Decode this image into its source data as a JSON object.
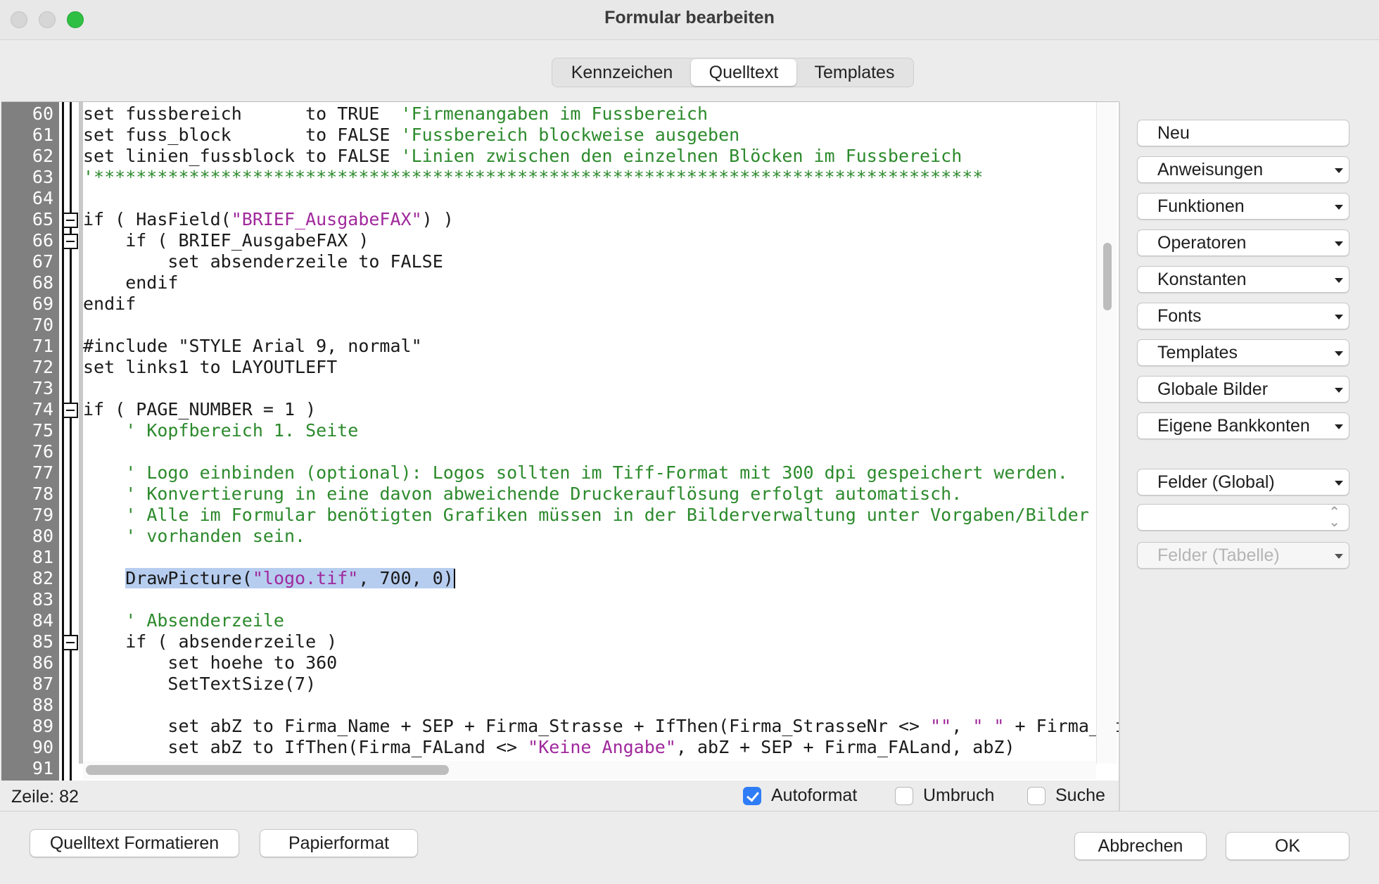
{
  "window": {
    "title": "Formular bearbeiten",
    "accent_color": "#2f7df6",
    "code_comment_color": "#2c8a2c",
    "code_string_color": "#a0289c",
    "selection_color": "#b6cdef"
  },
  "tabs": [
    {
      "label": "Kennzeichen",
      "selected": false
    },
    {
      "label": "Quelltext",
      "selected": true
    },
    {
      "label": "Templates",
      "selected": false
    }
  ],
  "editor": {
    "lines": [
      {
        "n": "60",
        "segs": [
          {
            "t": "set fussbereich      to TRUE  "
          },
          {
            "t": "'Firmenangaben im Fussbereich",
            "c": "com"
          }
        ]
      },
      {
        "n": "61",
        "segs": [
          {
            "t": "set fuss_block       to FALSE "
          },
          {
            "t": "'Fussbereich blockweise ausgeben",
            "c": "com"
          }
        ]
      },
      {
        "n": "62",
        "segs": [
          {
            "t": "set linien_fussblock to FALSE "
          },
          {
            "t": "'Linien zwischen den einzelnen Blöcken im Fussbereich",
            "c": "com"
          }
        ]
      },
      {
        "n": "63",
        "segs": [
          {
            "t": "'************************************************************************************",
            "c": "com"
          }
        ]
      },
      {
        "n": "64",
        "segs": []
      },
      {
        "n": "65",
        "fold": true,
        "segs": [
          {
            "t": "if ( HasField("
          },
          {
            "t": "\"BRIEF_AusgabeFAX\"",
            "c": "str"
          },
          {
            "t": ") )"
          }
        ]
      },
      {
        "n": "66",
        "fold": true,
        "segs": [
          {
            "t": "    if ( BRIEF_AusgabeFAX )"
          }
        ]
      },
      {
        "n": "67",
        "segs": [
          {
            "t": "        set absenderzeile to FALSE"
          }
        ]
      },
      {
        "n": "68",
        "segs": [
          {
            "t": "    endif"
          }
        ]
      },
      {
        "n": "69",
        "segs": [
          {
            "t": "endif"
          }
        ]
      },
      {
        "n": "70",
        "segs": []
      },
      {
        "n": "71",
        "segs": [
          {
            "t": "#include \"STYLE Arial 9, normal\""
          }
        ]
      },
      {
        "n": "72",
        "segs": [
          {
            "t": "set links1 to LAYOUTLEFT"
          }
        ]
      },
      {
        "n": "73",
        "segs": []
      },
      {
        "n": "74",
        "fold": true,
        "segs": [
          {
            "t": "if ( PAGE_NUMBER = 1 )"
          }
        ]
      },
      {
        "n": "75",
        "segs": [
          {
            "t": "    "
          },
          {
            "t": "' Kopfbereich 1. Seite",
            "c": "com"
          }
        ]
      },
      {
        "n": "76",
        "segs": []
      },
      {
        "n": "77",
        "segs": [
          {
            "t": "    "
          },
          {
            "t": "' Logo einbinden (optional): Logos sollten im Tiff-Format mit 300 dpi gespeichert werden.",
            "c": "com"
          }
        ]
      },
      {
        "n": "78",
        "segs": [
          {
            "t": "    "
          },
          {
            "t": "' Konvertierung in eine davon abweichende Druckerauflösung erfolgt automatisch.",
            "c": "com"
          }
        ]
      },
      {
        "n": "79",
        "segs": [
          {
            "t": "    "
          },
          {
            "t": "' Alle im Formular benötigten Grafiken müssen in der Bilderverwaltung unter Vorgaben/Bilder",
            "c": "com"
          }
        ]
      },
      {
        "n": "80",
        "segs": [
          {
            "t": "    "
          },
          {
            "t": "' vorhanden sein.",
            "c": "com"
          }
        ]
      },
      {
        "n": "81",
        "segs": []
      },
      {
        "n": "82",
        "caret": true,
        "segs": [
          {
            "t": "    "
          },
          {
            "t": "DrawPicture(",
            "sel": true
          },
          {
            "t": "\"logo.tif\"",
            "c": "str",
            "sel": true
          },
          {
            "t": ", 700, 0)",
            "sel": true
          }
        ]
      },
      {
        "n": "83",
        "segs": []
      },
      {
        "n": "84",
        "segs": [
          {
            "t": "    "
          },
          {
            "t": "' Absenderzeile",
            "c": "com"
          }
        ]
      },
      {
        "n": "85",
        "fold": true,
        "segs": [
          {
            "t": "    if ( absenderzeile )"
          }
        ]
      },
      {
        "n": "86",
        "segs": [
          {
            "t": "        set hoehe to 360"
          }
        ]
      },
      {
        "n": "87",
        "segs": [
          {
            "t": "        SetTextSize(7)"
          }
        ]
      },
      {
        "n": "88",
        "segs": []
      },
      {
        "n": "89",
        "segs": [
          {
            "t": "        set abZ to Firma_Name + SEP + Firma_Strasse + IfThen(Firma_StrasseNr <> "
          },
          {
            "t": "\"\"",
            "c": "str"
          },
          {
            "t": ", "
          },
          {
            "t": "\" \"",
            "c": "str"
          },
          {
            "t": " + Firma_StrasseNr"
          }
        ]
      },
      {
        "n": "90",
        "segs": [
          {
            "t": "        set abZ to IfThen(Firma_FALand <> "
          },
          {
            "t": "\"Keine Angabe\"",
            "c": "str"
          },
          {
            "t": ", abZ + SEP + Firma_FALand, abZ)"
          }
        ]
      },
      {
        "n": "91",
        "segs": []
      }
    ]
  },
  "right_panel": {
    "buttons": [
      {
        "label": "Neu",
        "dropdown": false
      },
      {
        "label": "Anweisungen",
        "dropdown": true
      },
      {
        "label": "Funktionen",
        "dropdown": true
      },
      {
        "label": "Operatoren",
        "dropdown": true
      },
      {
        "label": "Konstanten",
        "dropdown": true
      },
      {
        "label": "Fonts",
        "dropdown": true
      },
      {
        "label": "Templates",
        "dropdown": true
      },
      {
        "label": "Globale Bilder",
        "dropdown": true
      },
      {
        "label": "Eigene Bankkonten",
        "dropdown": true
      }
    ],
    "felder_global": "Felder (Global)",
    "felder_tabelle": "Felder (Tabelle)"
  },
  "status": {
    "line_label": "Zeile: 82",
    "checkboxes": [
      {
        "label": "Autoformat",
        "checked": true
      },
      {
        "label": "Umbruch",
        "checked": false
      },
      {
        "label": "Suche",
        "checked": false
      }
    ]
  },
  "footer": {
    "format_source": "Quelltext Formatieren",
    "paper_format": "Papierformat",
    "cancel": "Abbrechen",
    "ok": "OK"
  }
}
